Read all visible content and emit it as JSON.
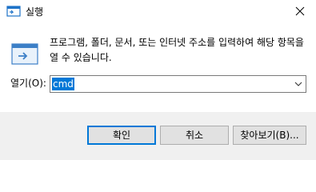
{
  "window": {
    "title": "실행",
    "icon": "run-window-icon",
    "close_icon": "close-icon"
  },
  "content": {
    "icon": "run-dialog-icon",
    "description": "프로그램, 폴더, 문서, 또는 인터넷 주소를 입력하여 해당 항목을 열 수 있습니다.",
    "open_label": "열기(O):",
    "open_value": "cmd",
    "dropdown_icon": "chevron-down-icon"
  },
  "buttons": {
    "ok": "확인",
    "cancel": "취소",
    "browse": "찾아보기(B)..."
  },
  "colors": {
    "accent": "#0078d7",
    "footer_bg": "#f0f0f0",
    "button_bg": "#e1e1e1"
  }
}
